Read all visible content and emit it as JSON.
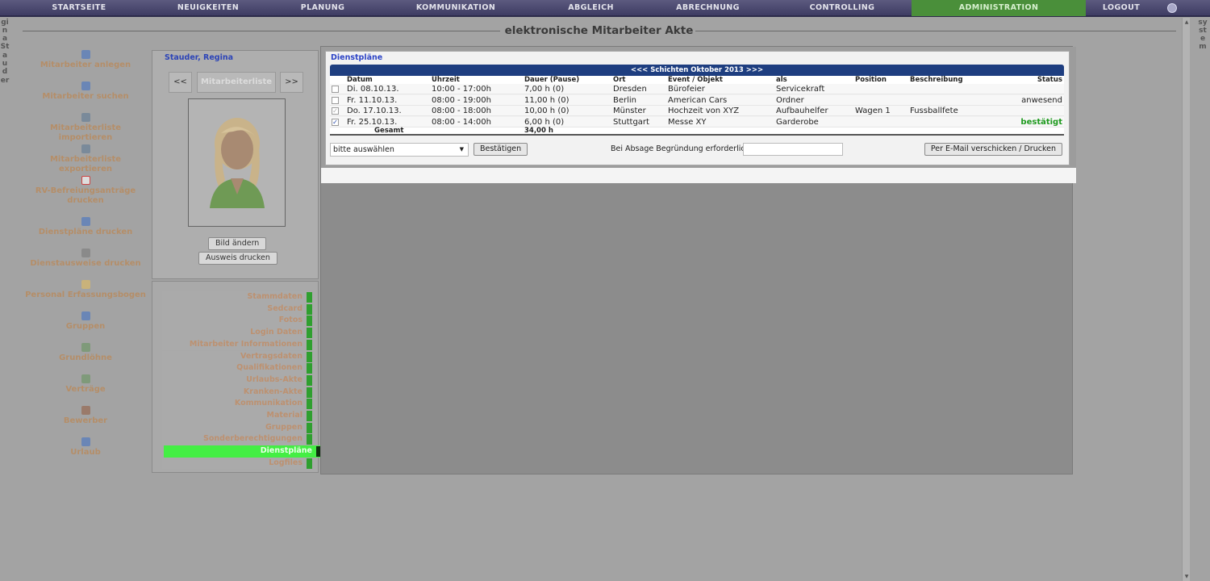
{
  "nav": {
    "items": [
      {
        "label": "STARTSEITE"
      },
      {
        "label": "NEUIGKEITEN"
      },
      {
        "label": "PLANUNG"
      },
      {
        "label": "KOMMUNIKATION"
      },
      {
        "label": "ABGLEICH"
      },
      {
        "label": "ABRECHNUNG"
      },
      {
        "label": "CONTROLLING"
      },
      {
        "label": "ADMINISTRATION",
        "active": true
      },
      {
        "label": "LOGOUT"
      }
    ],
    "user_icon": "user-help-icon"
  },
  "side_left_text": "Regina Stauder",
  "side_right_text": "Testsystem",
  "page_title": "elektronische Mitarbeiter Akte",
  "left_menu": [
    {
      "label": "Mitarbeiter anlegen",
      "icon": "person-add-icon"
    },
    {
      "label": "Mitarbeiter suchen",
      "icon": "person-search-icon"
    },
    {
      "label": "Mitarbeiterliste importieren",
      "icon": "people-import-icon"
    },
    {
      "label": "Mitarbeiterliste exportieren",
      "icon": "people-export-icon"
    },
    {
      "label": "RV-Befreiungsanträge drucken",
      "icon": "pdf-icon"
    },
    {
      "label": "Dienstpläne drucken",
      "icon": "person-print-icon"
    },
    {
      "label": "Dienstausweise drucken",
      "icon": "id-card-icon"
    },
    {
      "label": "Personal Erfassungsbogen",
      "icon": "form-icon"
    },
    {
      "label": "Gruppen",
      "icon": "group-icon"
    },
    {
      "label": "Grundlöhne",
      "icon": "wage-icon"
    },
    {
      "label": "Verträge",
      "icon": "contract-icon"
    },
    {
      "label": "Bewerber",
      "icon": "applicant-icon"
    },
    {
      "label": "Urlaub",
      "icon": "vacation-icon"
    }
  ],
  "employee": {
    "name": "Stauder, Regina",
    "prev_label": "<<",
    "list_label": "Mitarbeiterliste",
    "next_label": ">>",
    "change_photo_label": "Bild ändern",
    "print_id_label": "Ausweis drucken"
  },
  "sub_menu": [
    {
      "label": "Stammdaten"
    },
    {
      "label": "Sedcard"
    },
    {
      "label": "Fotos"
    },
    {
      "label": "Login Daten"
    },
    {
      "label": "Mitarbeiter Informationen"
    },
    {
      "label": "Vertragsdaten"
    },
    {
      "label": "Qualifikationen"
    },
    {
      "label": "Urlaubs-Akte"
    },
    {
      "label": "Kranken-Akte"
    },
    {
      "label": "Kommunikation"
    },
    {
      "label": "Material"
    },
    {
      "label": "Gruppen"
    },
    {
      "label": "Sonderberechtigungen"
    },
    {
      "label": "Dienstpläne",
      "active": true
    },
    {
      "label": "Logfiles"
    }
  ],
  "dienstplaene": {
    "legend": "Dienstpläne",
    "header": "<<<   Schichten Oktober 2013 >>>",
    "columns": [
      "Datum",
      "Uhrzeit",
      "Dauer (Pause)",
      "Ort",
      "Event / Objekt",
      "als",
      "Position",
      "Beschreibung",
      "Status"
    ],
    "rows": [
      {
        "checked": false,
        "datum": "Di. 08.10.13.",
        "uhrzeit": "10:00 - 17:00h",
        "dauer": "7,00 h (0)",
        "ort": "Dresden",
        "event": "Bürofeier",
        "als": "Servicekraft",
        "position": "",
        "beschreibung": "",
        "status": ""
      },
      {
        "checked": false,
        "datum": "Fr. 11.10.13.",
        "uhrzeit": "08:00 - 19:00h",
        "dauer": "11,00 h (0)",
        "ort": "Berlin",
        "event": "American Cars",
        "als": "Ordner",
        "position": "",
        "beschreibung": "",
        "status": "anwesend"
      },
      {
        "checked": true,
        "disabled": true,
        "datum": "Do. 17.10.13.",
        "uhrzeit": "08:00 - 18:00h",
        "dauer": "10,00 h (0)",
        "ort": "Münster",
        "event": "Hochzeit von XYZ",
        "als": "Aufbauhelfer",
        "position": "Wagen 1",
        "beschreibung": "Fussballfete",
        "status": ""
      },
      {
        "checked": true,
        "datum": "Fr. 25.10.13.",
        "uhrzeit": "08:00 - 14:00h",
        "dauer": "6,00 h (0)",
        "ort": "Stuttgart",
        "event": "Messe XY",
        "als": "Garderobe",
        "position": "",
        "beschreibung": "",
        "status": "bestätigt"
      }
    ],
    "total_label": "Gesamt",
    "total_value": "34,00 h",
    "select_value": "bitte auswählen",
    "confirm_label": "Bestätigen",
    "reason_label": "Bei Absage Begründung erforderlich",
    "reason_value": "",
    "email_print_label": "Per E-Mail verschicken / Drucken",
    "status_confirmed_color": "#1f9a1f"
  }
}
